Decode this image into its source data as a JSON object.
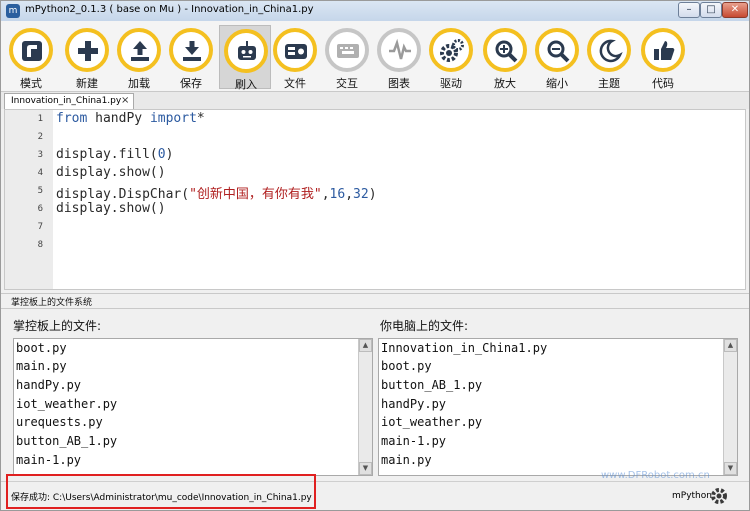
{
  "window": {
    "title": "mPython2_0.1.3 ( base on Mu ) - Innovation_in_China1.py",
    "app_icon": "python-icon",
    "controls": [
      "minimize",
      "maximize",
      "close"
    ]
  },
  "toolbar": {
    "items": [
      {
        "label": "模式",
        "icon": "mode-icon",
        "accent": "#f4c020"
      },
      {
        "label": "新建",
        "icon": "plus-icon",
        "accent": "#f4c020"
      },
      {
        "label": "加载",
        "icon": "upload-icon",
        "accent": "#f4c020"
      },
      {
        "label": "保存",
        "icon": "download-icon",
        "accent": "#f4c020"
      },
      {
        "label": "刷入",
        "icon": "robot-icon",
        "accent": "#f4c020",
        "active": true
      },
      {
        "label": "文件",
        "icon": "files-icon",
        "accent": "#f4c020"
      },
      {
        "label": "交互",
        "icon": "keyboard-icon",
        "accent": "#c6c6c6"
      },
      {
        "label": "图表",
        "icon": "waveform-icon",
        "accent": "#c6c6c6"
      },
      {
        "label": "驱动",
        "icon": "gears-icon",
        "accent": "#f4c020"
      },
      {
        "label": "放大",
        "icon": "zoom-in-icon",
        "accent": "#f4c020"
      },
      {
        "label": "缩小",
        "icon": "zoom-out-icon",
        "accent": "#f4c020"
      },
      {
        "label": "主题",
        "icon": "moon-icon",
        "accent": "#f4c020"
      },
      {
        "label": "代码",
        "icon": "thumbs-up-icon",
        "accent": "#f4c020"
      }
    ]
  },
  "tab": {
    "label": "Innovation_in_China1.py",
    "close": "×"
  },
  "editor": {
    "line_numbers": [
      "1",
      "2",
      "3",
      "4",
      "5",
      "6",
      "7",
      "8"
    ],
    "lines": {
      "l1": {
        "kw1": "from",
        "mod": " handPy ",
        "kw2": "import",
        "rest": "*"
      },
      "l3": {
        "a": "display.fill(",
        "n": "0",
        "b": ")"
      },
      "l4": "display.show()",
      "l5": {
        "a": "display.DispChar(",
        "s": "\"创新中国，有你有我\"",
        "c": ",",
        "n1": "16",
        "c2": ",",
        "n2": "32",
        "b": ")"
      },
      "l6": "display.show()"
    }
  },
  "filesystem": {
    "title": "掌控板上的文件系统",
    "board_header": "掌控板上的文件:",
    "pc_header": "你电脑上的文件:",
    "board_files": [
      "boot.py",
      "main.py",
      "handPy.py",
      "iot_weather.py",
      "urequests.py",
      "button_AB_1.py",
      "main-1.py"
    ],
    "pc_files": [
      "Innovation_in_China1.py",
      "boot.py",
      "button_AB_1.py",
      "handPy.py",
      "iot_weather.py",
      "main-1.py",
      "main.py"
    ]
  },
  "status": {
    "message": "保存成功: C:\\Users\\Administrator\\mu_code\\Innovation_in_China1.py",
    "mode": "mPython",
    "watermark": "www.DFRobot.com.cn"
  }
}
